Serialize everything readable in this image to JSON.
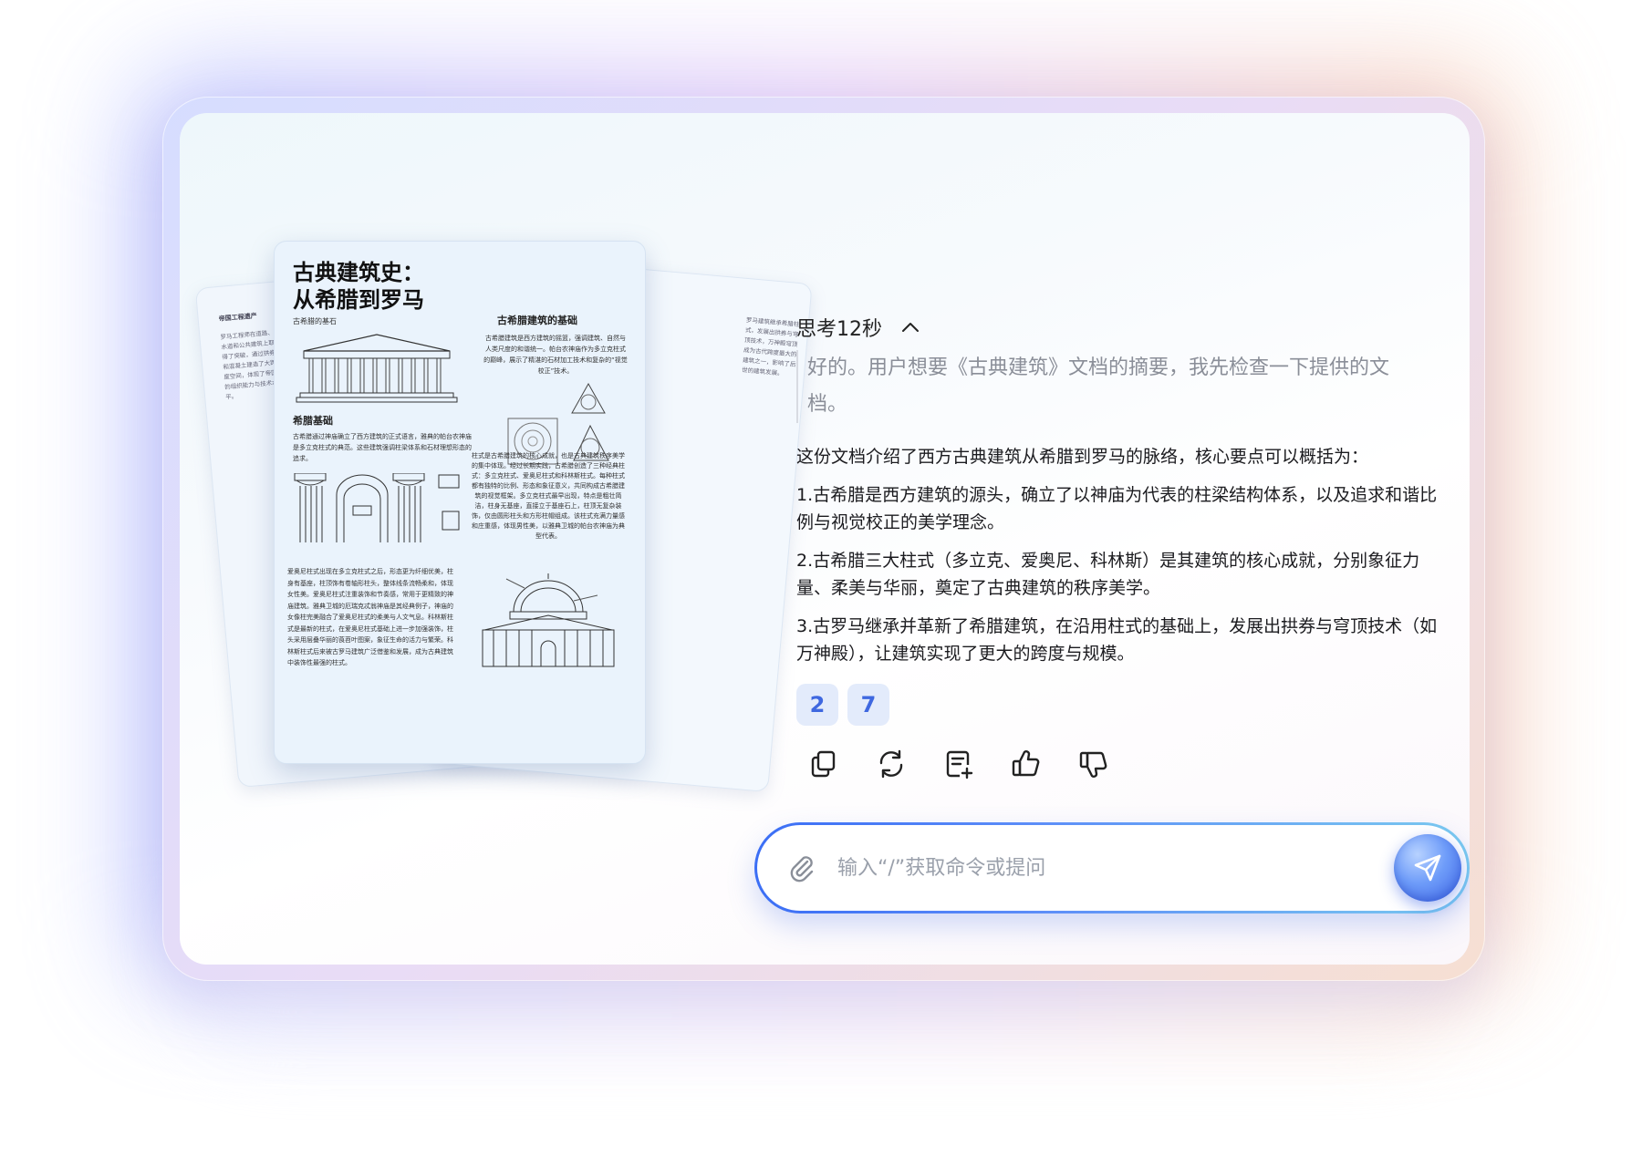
{
  "document": {
    "title_line1": "古典建筑史：",
    "title_line2": "从希腊到罗马",
    "caption": "古希腊的基石",
    "section_greek_foundation_title": "古希腊建筑的基础",
    "section_greek_foundation_text": "古希腊建筑是西方建筑的摇篮，强调建筑、自然与人类尺度的和谐统一。帕台农神庙作为多立克柱式的巅峰，展示了精湛的石材加工技术和复杂的“视觉校正”技术。",
    "section_basics_title": "希腊基础",
    "section_basics_text": "古希腊通过神庙确立了西方建筑的正式语言，雅典的帕台农神庙是多立克柱式的典范。这些建筑强调柱梁体系和石材理想形态的追求。",
    "section_orders_text": "柱式是古希腊建筑的核心成就，也是古典建筑秩序美学的集中体现。经过长期实践，古希腊创造了三种经典柱式：多立克柱式、爱奥尼柱式和科林斯柱式。每种柱式都有独特的比例、形态和象征意义，共同构成古希腊建筑的视觉框架。多立克柱式最早出现，特点是粗壮简洁，柱身无基座，直接立于基座石上，柱顶无复杂装饰，仅由圆形柱头和方形柱帽组成。该柱式充满力量感和庄重感，体现男性美，以雅典卫城的帕台农神庙为典型代表。",
    "section_ionic_text": "爱奥尼柱式出现在多立克柱式之后，形态更为纤细优美，柱身有基座，柱顶饰有卷轴形柱头，整体线条流畅柔和，体现女性美。爱奥尼柱式注重装饰和节奏感，常用于更精致的神庙建筑。雅典卫城的厄瑞克忒翁神庙是其经典例子，神庙的女像柱完美融合了爱奥尼柱式的柔美与人文气息。科林斯柱式是最新的柱式，在爱奥尼柱式基础上进一步加强装饰，柱头采用层叠华丽的莨苕叶图案，象征生命的活力与繁荣。科林斯柱式后来被古罗马建筑广泛借鉴和发展，成为古典建筑中装饰性最强的柱式。",
    "back_left_title": "帝国工程遗产",
    "back_left_text": "罗马工程师在道路、水道和公共建筑上取得了突破，通过拱券和混凝土建造了大跨度空间，体现了帝国的组织能力与技术水平。",
    "back_right_text": "罗马建筑继承希腊柱式，发展出拱券与穹顶技术，万神殿穹顶成为古代跨度最大的建筑之一，影响了后世的建筑发展。"
  },
  "chat": {
    "thinking_label": "思考12秒",
    "reasoning_text": "好的。用户想要《古典建筑》文档的摘要，我先检查一下提供的文档。",
    "answer_intro": "这份文档介绍了西方古典建筑从希腊到罗马的脉络，核心要点可以概括为：",
    "answer_point_1": "1.古希腊是西方建筑的源头，确立了以神庙为代表的柱梁结构体系，以及追求和谐比例与视觉校正的美学理念。",
    "answer_point_2": "2.古希腊三大柱式（多立克、爱奥尼、科林斯）是其建筑的核心成就，分别象征力量、柔美与华丽，奠定了古典建筑的秩序美学。",
    "answer_point_3": "3.古罗马继承并革新了希腊建筑，在沿用柱式的基础上，发展出拱券与穹顶技术（如万神殿），让建筑实现了更大的跨度与规模。",
    "references": [
      "2",
      "7"
    ]
  },
  "actions": {
    "copy_icon": "copy-icon",
    "regenerate_icon": "refresh-icon",
    "note_icon": "add-note-icon",
    "like_icon": "thumbs-up-icon",
    "dislike_icon": "thumbs-down-icon"
  },
  "input": {
    "placeholder": "输入“/”获取命令或提问",
    "value": ""
  },
  "colors": {
    "accent": "#3f68e0",
    "chip_bg": "#e3ebfb",
    "reasoning_text": "#8a8e98"
  }
}
